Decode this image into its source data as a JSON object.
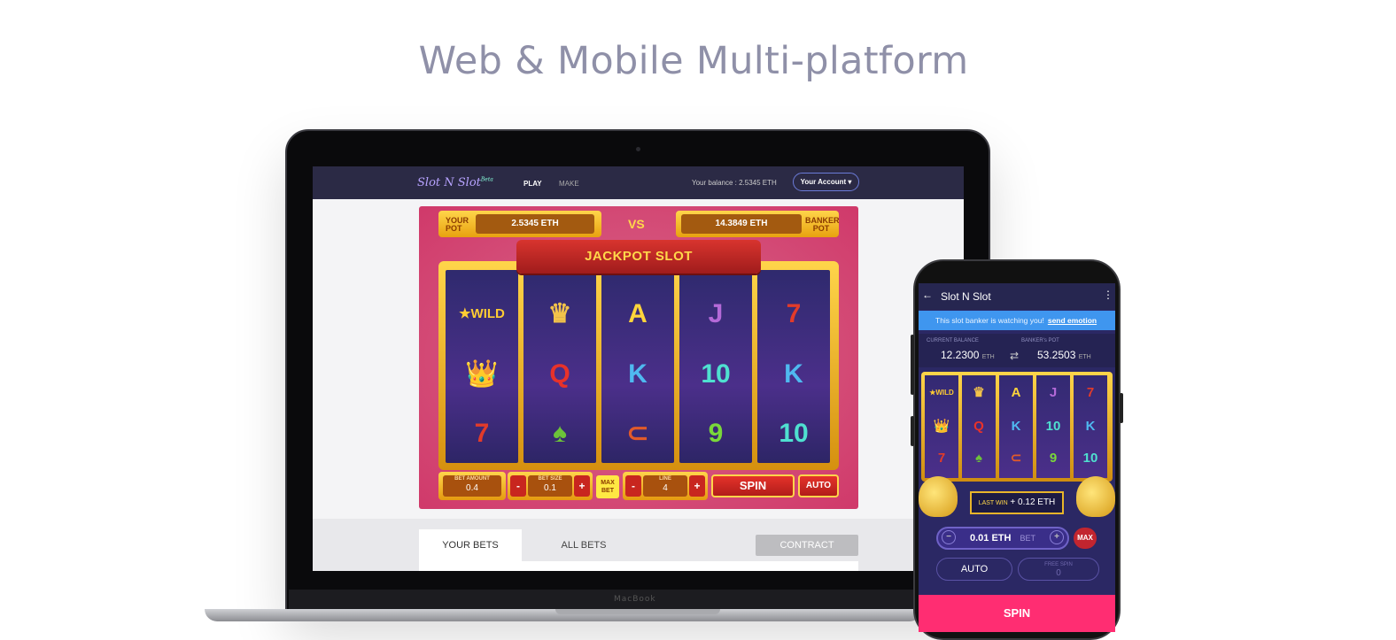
{
  "page_title": "Web & Mobile Multi-platform",
  "laptop_brand": "MacBook",
  "web": {
    "logo": "Slot N Slot",
    "logo_sup": "Beta",
    "nav_play": "PLAY",
    "nav_make": "MAKE",
    "balance": "Your balance : 2.5345 ETH",
    "account": "Your Account ▾",
    "your_pot_label": "YOUR POT",
    "your_pot_value": "2.5345 ETH",
    "vs": "VS",
    "banker_pot_label": "BANKER POT",
    "banker_pot_value": "14.3849 ETH",
    "banner": "JACKPOT SLOT",
    "reels": [
      [
        "★WILD",
        "👑",
        "7"
      ],
      [
        "♛",
        "Q",
        "♠"
      ],
      [
        "A",
        "K",
        "⊂"
      ],
      [
        "J",
        "10",
        "9"
      ],
      [
        "7",
        "K",
        "10"
      ]
    ],
    "bet_amount_label": "BET AMOUNT",
    "bet_amount_value": "0.4",
    "minus": "-",
    "plus": "+",
    "bet_size_label": "BET SIZE",
    "bet_size_value": "0.1",
    "max_bet": "MAX BET",
    "line_label": "LINE",
    "line_value": "4",
    "spin": "SPIN",
    "auto": "AUTO",
    "tab_your_bets": "YOUR BETS",
    "tab_all_bets": "ALL BETS",
    "contract": "CONTRACT"
  },
  "mobile": {
    "back": "←",
    "title": "Slot N Slot",
    "menu": "⋮",
    "notice": "This slot banker is watching you!",
    "notice_link": "send emotion",
    "current_balance_label": "CURRENT BALANCE",
    "current_balance": "12.2300",
    "bankers_pot_label": "BANKER's POT",
    "bankers_pot": "53.2503",
    "unit": "ETH",
    "swap": "⇄",
    "last_win_label": "LAST WIN",
    "last_win_value": "+ 0.12 ETH",
    "bet_value": "0.01 ETH",
    "bet_label": "BET",
    "minus": "−",
    "plus": "+",
    "max": "MAX",
    "auto": "AUTO",
    "free_spin_label": "FREE SPIN",
    "free_spin_value": "0",
    "spin": "SPIN"
  },
  "colors": {
    "accent_pink": "#ff2d72",
    "nav_dark": "#2b2a45",
    "gold": "#ffd54a",
    "notice_blue": "#3f96ef"
  }
}
